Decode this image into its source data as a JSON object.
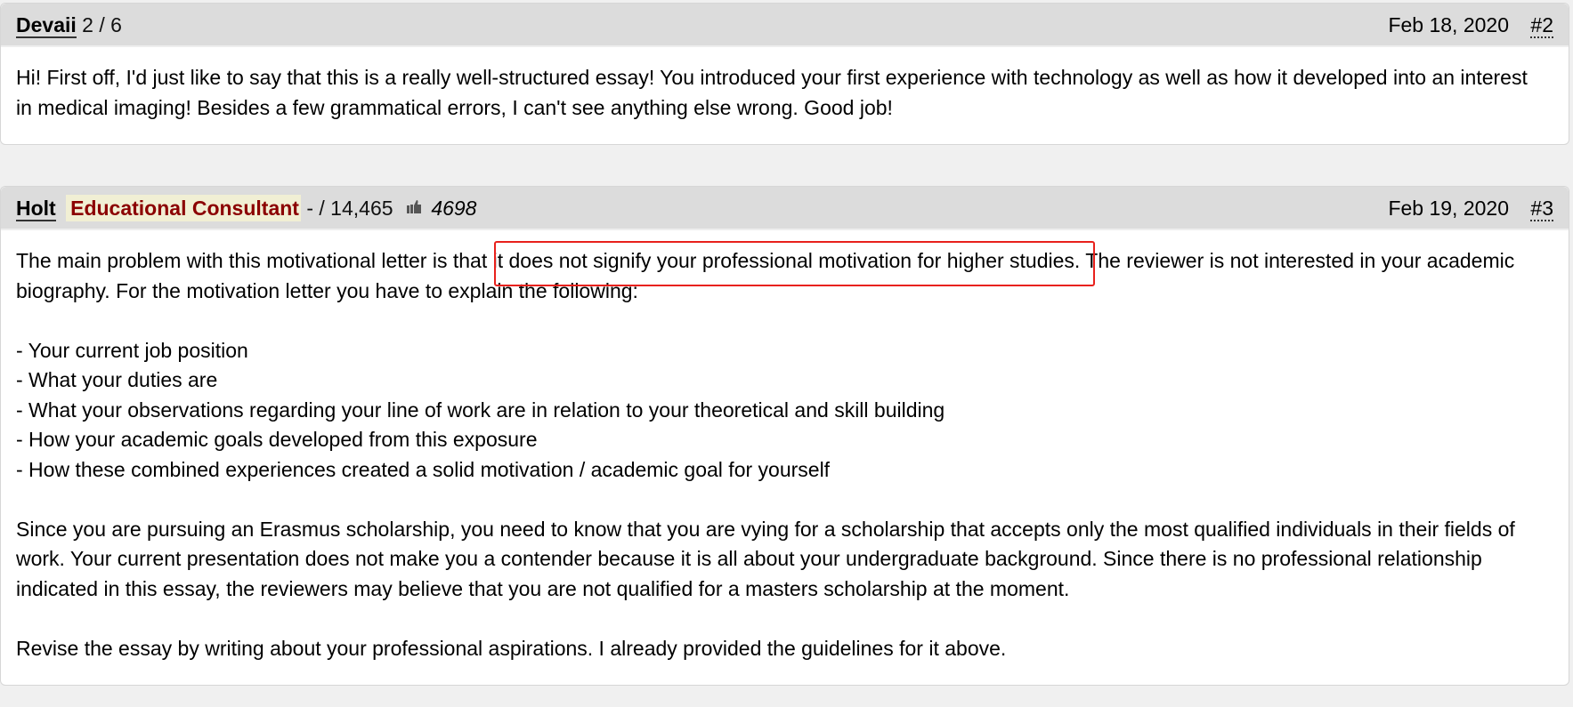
{
  "posts": [
    {
      "author": "Devaii",
      "author_meta": "2 / 6",
      "date": "Feb 18, 2020",
      "post_number": "#2",
      "body": {
        "paragraph_1_line_1": "Hi! First off, I'd just like to say that this is a really well-structured essay! You introduced your first experience with technology as well as how it developed into an interest",
        "paragraph_1_line_2": "in medical imaging! Besides a few grammatical errors, I can't see anything else wrong. Good job!"
      }
    },
    {
      "author": "Holt",
      "badge": "Educational Consultant",
      "author_meta": "- / 14,465",
      "likes_icon": "thumbs-up-icon",
      "likes": "4698",
      "date": "Feb 19, 2020",
      "post_number": "#3",
      "body": {
        "intro_before_highlight": "The main problem with this motivational letter is that ",
        "intro_highlight": "it does not signify your professional motivation for higher studies.",
        "intro_after_highlight": " The reviewer is not interested in your academic biography. For the motivation letter you have to explain the following:",
        "list": [
          "- Your current job position",
          "- What your duties are",
          "- What your observations regarding your line of work are in relation to your theoretical and skill building",
          "- How your academic goals developed from this exposure",
          "- How these combined experiences created a solid motivation / academic goal for yourself"
        ],
        "paragraph_2": "Since you are pursuing an Erasmus scholarship, you need to know that you are vying for a scholarship that accepts only the most qualified individuals in their fields of work. Your current presentation does not make you a contender because it is all about your undergraduate background. Since there is no professional relationship indicated in this essay, the reviewers may believe that you are not qualified for a masters scholarship at the moment.",
        "paragraph_3": "Revise the essay by writing about your professional aspirations. I already provided the guidelines for it above."
      }
    }
  ],
  "annotation": {
    "type": "highlight-box",
    "color": "#e8211c"
  }
}
